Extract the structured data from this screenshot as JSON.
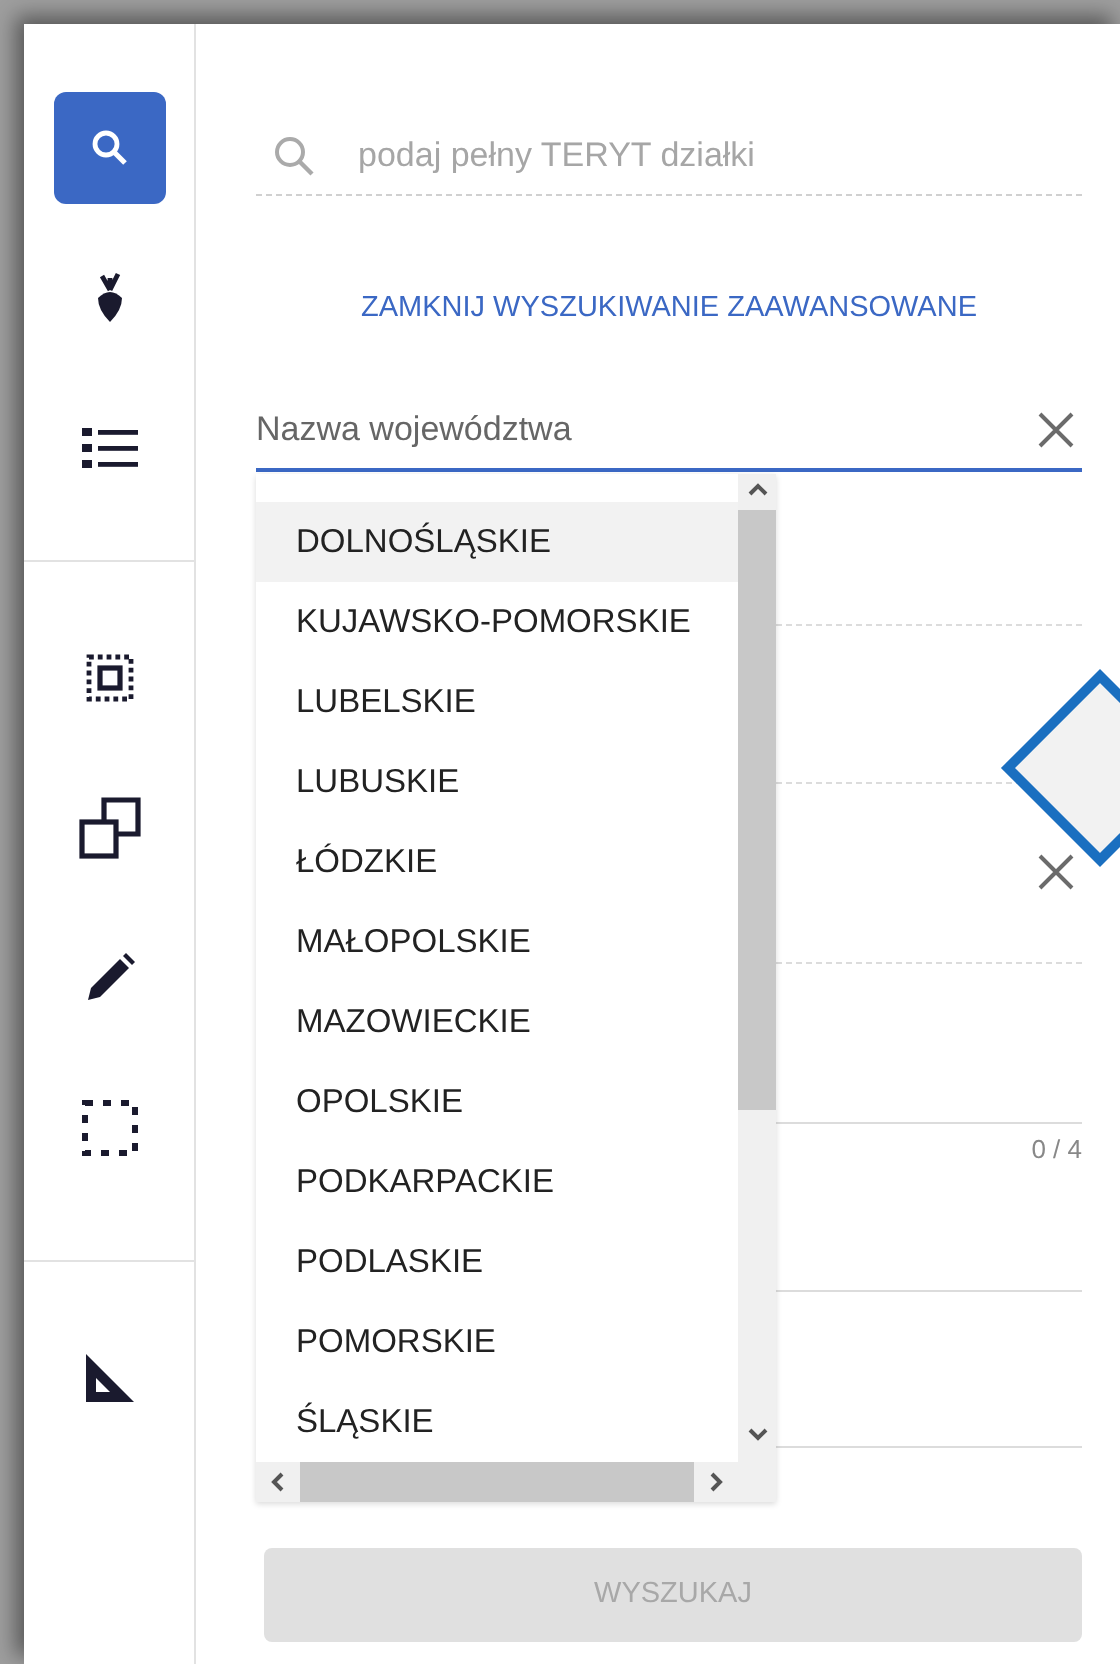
{
  "sidebar": {
    "groups": [
      [
        {
          "kind": "search",
          "selected": true
        },
        {
          "kind": "beet",
          "selected": false
        },
        {
          "kind": "list",
          "selected": false
        }
      ],
      [
        {
          "kind": "select-inside",
          "selected": false
        },
        {
          "kind": "copy",
          "selected": false
        },
        {
          "kind": "pencil",
          "selected": false
        },
        {
          "kind": "dashed-rect",
          "selected": false
        }
      ],
      [
        {
          "kind": "set-square",
          "selected": false
        }
      ]
    ]
  },
  "search": {
    "placeholder": "podaj pełny TERYT działki"
  },
  "advanced_link": "ZAMKNIJ WYSZUKIWANIE ZAAWANSOWANE",
  "voivodeship_field": {
    "placeholder": "Nazwa województwa",
    "expanded": true
  },
  "options": [
    {
      "label": "DOLNOŚLĄSKIE",
      "selected": true
    },
    {
      "label": "KUJAWSKO-POMORSKIE",
      "selected": false
    },
    {
      "label": "LUBELSKIE",
      "selected": false
    },
    {
      "label": "LUBUSKIE",
      "selected": false
    },
    {
      "label": "ŁÓDZKIE",
      "selected": false
    },
    {
      "label": "MAŁOPOLSKIE",
      "selected": false
    },
    {
      "label": "MAZOWIECKIE",
      "selected": false
    },
    {
      "label": "OPOLSKIE",
      "selected": false
    },
    {
      "label": "PODKARPACKIE",
      "selected": false
    },
    {
      "label": "PODLASKIE",
      "selected": false
    },
    {
      "label": "POMORSKIE",
      "selected": false
    },
    {
      "label": "ŚLĄSKIE",
      "selected": false
    }
  ],
  "counter": "0 / 4",
  "submit": {
    "label": "WYSZUKAJ",
    "disabled": true
  }
}
